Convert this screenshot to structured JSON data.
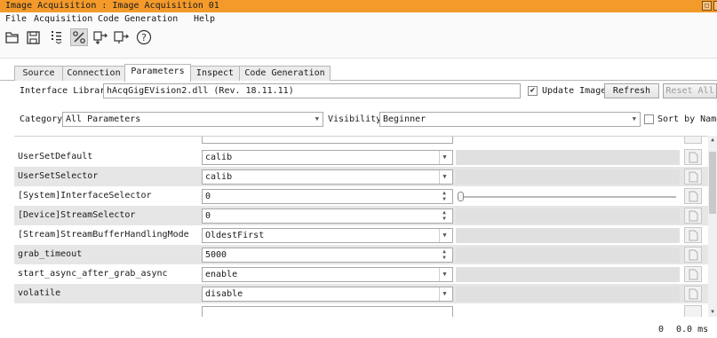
{
  "window": {
    "title": "Image Acquisition : Image Acquisition 01",
    "controls": [
      "restore-icon",
      "close-icon"
    ]
  },
  "menu": [
    "File",
    "Acquisition",
    "Code Generation",
    "Help"
  ],
  "toolbar": {
    "icons": [
      "open-icon",
      "save-icon",
      "grab-single-icon",
      "live-icon",
      "transfer-icon",
      "insert-code-icon",
      "help-icon"
    ],
    "help_glyph": "?"
  },
  "tabs": [
    "Source",
    "Connection",
    "Parameters",
    "Inspect",
    "Code Generation"
  ],
  "selected_tab": "Parameters",
  "interface_library": {
    "label": "Interface Library",
    "value": "hAcqGigEVision2.dll (Rev. 18.11.11)",
    "update_image_label": "Update Image",
    "update_image_checked": true,
    "refresh_label": "Refresh",
    "reset_all_label": "Reset All"
  },
  "filters": {
    "category_label": "Category",
    "category_value": "All Parameters",
    "visibility_label": "Visibility",
    "visibility_value": "Beginner",
    "sort_label": "Sort by Name",
    "sort_checked": false
  },
  "parameters": [
    {
      "name": "UserSetDefault",
      "value": "calib",
      "control": "combo",
      "extra": "gray"
    },
    {
      "name": "UserSetSelector",
      "value": "calib",
      "control": "combo",
      "extra": "gray"
    },
    {
      "name": "[System]InterfaceSelector",
      "value": "0",
      "control": "spin",
      "extra": "slider"
    },
    {
      "name": "[Device]StreamSelector",
      "value": "0",
      "control": "spin",
      "extra": "gray"
    },
    {
      "name": "[Stream]StreamBufferHandlingMode",
      "value": "OldestFirst",
      "control": "combo",
      "extra": "gray"
    },
    {
      "name": "grab_timeout",
      "value": "5000",
      "control": "spin",
      "extra": "gray"
    },
    {
      "name": "start_async_after_grab_async",
      "value": "enable",
      "control": "combo",
      "extra": "gray"
    },
    {
      "name": "volatile",
      "value": "disable",
      "control": "combo",
      "extra": "gray"
    }
  ],
  "status": {
    "count": "0",
    "time": "0.0 ms"
  },
  "colors": {
    "titlebar": "#f39a2b",
    "row_alt": "#e6e6e6"
  }
}
